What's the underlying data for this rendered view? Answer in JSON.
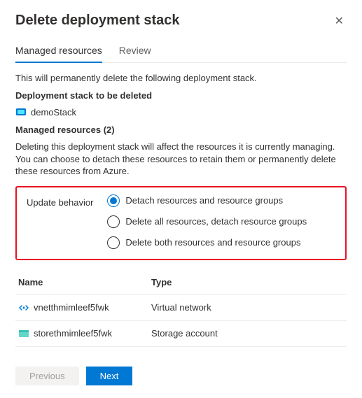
{
  "header": {
    "title": "Delete deployment stack"
  },
  "tabs": {
    "managed": "Managed resources",
    "review": "Review"
  },
  "intro": "This will permanently delete the following deployment stack.",
  "stack_heading": "Deployment stack to be deleted",
  "stack_name": "demoStack",
  "managed_heading": "Managed resources (2)",
  "managed_info": "Deleting this deployment stack will affect the resources it is currently managing. You can choose to detach these resources to retain them or permanently delete these resources from Azure.",
  "behavior": {
    "label": "Update behavior",
    "options": {
      "detach": "Detach resources and resource groups",
      "delete_res": "Delete all resources, detach resource groups",
      "delete_both": "Delete both resources and resource groups"
    }
  },
  "table": {
    "head_name": "Name",
    "head_type": "Type",
    "rows": [
      {
        "name": "vnetthmimleef5fwk",
        "type": "Virtual network"
      },
      {
        "name": "storethmimleef5fwk",
        "type": "Storage account"
      }
    ]
  },
  "buttons": {
    "prev": "Previous",
    "next": "Next"
  }
}
